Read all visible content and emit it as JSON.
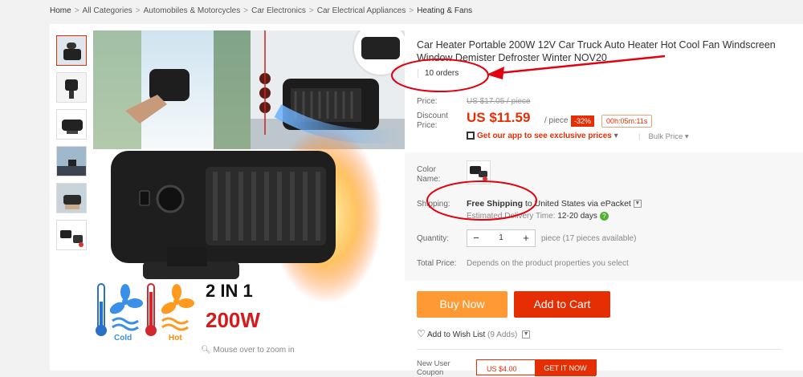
{
  "breadcrumb": {
    "items": [
      "Home",
      "All Categories",
      "Automobiles & Motorcycles",
      "Car Electronics",
      "Car Electrical Appliances",
      "Heating & Fans"
    ],
    "separator": ">"
  },
  "gallery": {
    "zoom_hint": "Mouse over to zoom in",
    "promo_big": "2 IN 1",
    "promo_power": "200W",
    "cold_label": "Cold",
    "hot_label": "Hot"
  },
  "product": {
    "title": "Car Heater Portable 200W 12V Car Truck Auto Heater Hot Cool Fan Windscreen Window Demister Defroster Winter NOV20",
    "orders": "10 orders"
  },
  "pricing": {
    "price_label": "Price:",
    "old_price": "US $17.05 / piece",
    "discount_label": "Discount Price:",
    "discount_price": "US $11.59",
    "per_unit": "/ piece",
    "discount_pct": "-32%",
    "countdown": "00h:05m:11s",
    "app_promo": "Get our app to see exclusive prices",
    "bulk_price": "Bulk Price"
  },
  "options": {
    "color_label": "Color Name:",
    "shipping_label": "Shipping:",
    "shipping_free": "Free Shipping",
    "shipping_rest": "to United States via ePacket",
    "est_label": "Estimated Delivery Time:",
    "est_days": "12-20 days",
    "quantity_label": "Quantity:",
    "quantity_value": "1",
    "quantity_avail": "piece (17 pieces available)",
    "total_label": "Total Price:",
    "total_text": "Depends on the product properties you select"
  },
  "actions": {
    "buy_now": "Buy Now",
    "add_to_cart": "Add to Cart",
    "wishlist": "Add to Wish List",
    "wishlist_count": "(9 Adds)"
  },
  "coupon": {
    "new_user": "New User Coupon",
    "amount": "US $4.00",
    "get_it": "GET IT NOW"
  },
  "colors": {
    "accent": "#e62e04",
    "buy": "#ff9933",
    "annotation": "#e3000f"
  }
}
